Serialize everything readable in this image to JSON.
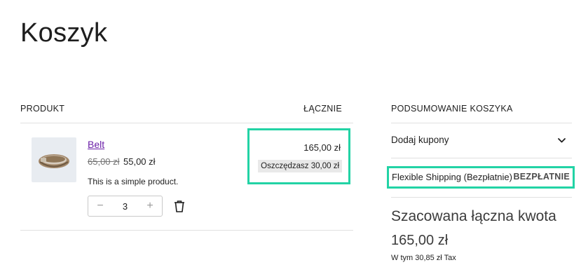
{
  "page": {
    "title": "Koszyk"
  },
  "cart_table": {
    "header_product": "PRODUKT",
    "header_total": "ŁĄCZNIE",
    "items": [
      {
        "name": "Belt",
        "regular_price": "65,00 zł",
        "sale_price": "55,00 zł",
        "description": "This is a simple product.",
        "quantity": "3",
        "line_total": "165,00 zł",
        "savings": "Oszczędzasz 30,00 zł",
        "image_icon": "belt-image"
      }
    ],
    "quantity_decrease": "−",
    "quantity_increase": "+"
  },
  "summary": {
    "header": "PODSUMOWANIE KOSZYKA",
    "coupon_label": "Dodaj kupony",
    "shipping_name": "Flexible Shipping (Bezpłatnie)",
    "shipping_price": "BEZPŁATNIE",
    "estimated_label": "Szacowana łączna kwota",
    "estimated_total": "165,00 zł",
    "tax_note": "W tym 30,85 zł Tax"
  },
  "colors": {
    "highlight": "#22d3a5",
    "link": "#6b1fa8"
  }
}
